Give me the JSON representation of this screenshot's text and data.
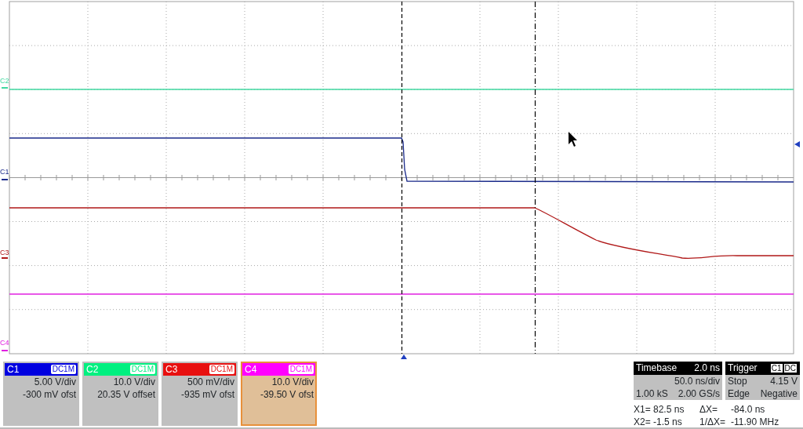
{
  "trace_markers": [
    {
      "label": "C2",
      "color": "#40d8a0"
    },
    {
      "label": "C1",
      "color": "#1a2a8a"
    },
    {
      "label": "C3",
      "color": "#b01818"
    },
    {
      "label": "C4",
      "color": "#e020e0"
    }
  ],
  "channels": [
    {
      "label": "C1",
      "coupling": "DC1M",
      "color": "#0000e0",
      "scale": "5.00 V/div",
      "offset": "-300 mV ofst",
      "selected": false
    },
    {
      "label": "C2",
      "coupling": "DC1M",
      "color": "#00f080",
      "scale": "10.0 V/div",
      "offset": "20.35 V offset",
      "selected": false
    },
    {
      "label": "C3",
      "coupling": "DC1M",
      "color": "#e81010",
      "scale": "500 mV/div",
      "offset": "-935 mV ofst",
      "selected": false
    },
    {
      "label": "C4",
      "coupling": "DC1M",
      "color": "#ff00ff",
      "scale": "10.0 V/div",
      "offset": "-39.50 V ofst",
      "selected": true
    }
  ],
  "timebase": {
    "title": "Timebase",
    "delay": "2.0 ns",
    "per_div": "50.0 ns/div",
    "samples": "1.00 kS",
    "rate": "2.00 GS/s"
  },
  "trigger": {
    "title": "Trigger",
    "source": "C1",
    "coupling": "DC",
    "mode": "Stop",
    "level": "4.15 V",
    "type": "Edge",
    "slope": "Negative"
  },
  "cursors": [
    {
      "label": "X1= 82.5 ns",
      "delta_label": "ΔX=",
      "delta_value": "-84.0 ns"
    },
    {
      "label": "X2= -1.5 ns",
      "delta_label": "1/ΔX=",
      "delta_value": "-11.90 MHz"
    }
  ]
}
